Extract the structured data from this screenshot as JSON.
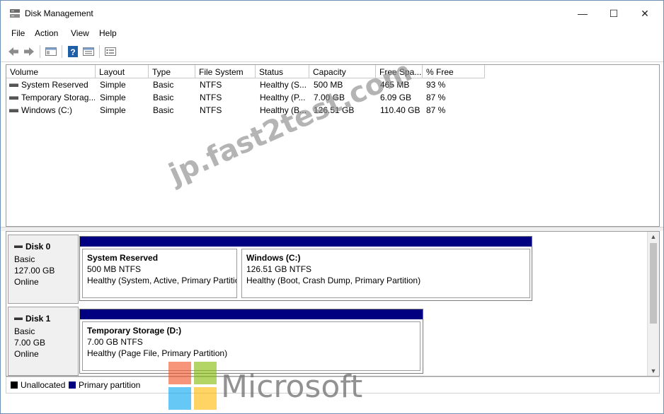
{
  "window": {
    "title": "Disk Management",
    "controls": {
      "minimize": "—",
      "maximize": "☐",
      "close": "✕"
    }
  },
  "menu": [
    "File",
    "Action",
    "View",
    "Help"
  ],
  "volume_list": {
    "columns": [
      "Volume",
      "Layout",
      "Type",
      "File System",
      "Status",
      "Capacity",
      "Free Spa...",
      "% Free"
    ],
    "rows": [
      [
        "System Reserved",
        "Simple",
        "Basic",
        "NTFS",
        "Healthy (S...",
        "500 MB",
        "465 MB",
        "93 %"
      ],
      [
        "Temporary Storag...",
        "Simple",
        "Basic",
        "NTFS",
        "Healthy (P...",
        "7.00 GB",
        "6.09 GB",
        "87 %"
      ],
      [
        "Windows (C:)",
        "Simple",
        "Basic",
        "NTFS",
        "Healthy (B...",
        "126.51 GB",
        "110.40 GB",
        "87 %"
      ]
    ]
  },
  "disks": [
    {
      "name": "Disk 0",
      "type": "Basic",
      "size": "127.00 GB",
      "status": "Online",
      "partitions": [
        {
          "name": "System Reserved",
          "size": "500 MB NTFS",
          "status": "Healthy (System, Active, Primary Partitio"
        },
        {
          "name": "Windows  (C:)",
          "size": "126.51 GB NTFS",
          "status": "Healthy (Boot, Crash Dump, Primary Partition)"
        }
      ]
    },
    {
      "name": "Disk 1",
      "type": "Basic",
      "size": "7.00 GB",
      "status": "Online",
      "partitions": [
        {
          "name": "Temporary Storage  (D:)",
          "size": "7.00 GB NTFS",
          "status": "Healthy (Page File, Primary Partition)"
        }
      ]
    }
  ],
  "legend": [
    {
      "label": "Unallocated",
      "color": "#000000"
    },
    {
      "label": "Primary partition",
      "color": "#000080"
    }
  ],
  "colors": {
    "primary_partition": "#000080",
    "unallocated": "#000000",
    "window_border": "#6e8fb5"
  },
  "overlays": {
    "watermark": "jp.fast2test.com",
    "brand": "Microsoft"
  }
}
